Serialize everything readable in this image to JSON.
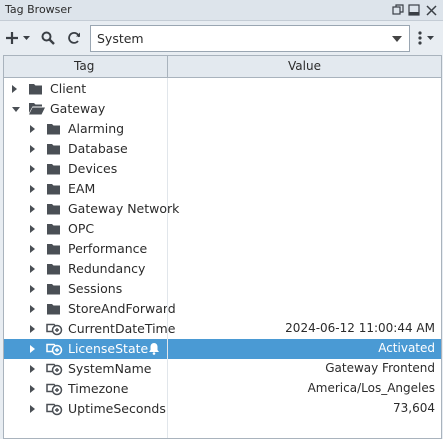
{
  "window": {
    "title": "Tag Browser"
  },
  "toolbar": {
    "provider": "System"
  },
  "table": {
    "col_tag": "Tag",
    "col_value": "Value"
  },
  "rows": [
    {
      "label": "Client",
      "value": "",
      "kind": "folder",
      "depth": 0,
      "expand": "right",
      "selected": false
    },
    {
      "label": "Gateway",
      "value": "",
      "kind": "folder-open",
      "depth": 0,
      "expand": "down",
      "selected": false
    },
    {
      "label": "Alarming",
      "value": "",
      "kind": "folder",
      "depth": 1,
      "expand": "right",
      "selected": false
    },
    {
      "label": "Database",
      "value": "",
      "kind": "folder",
      "depth": 1,
      "expand": "right",
      "selected": false
    },
    {
      "label": "Devices",
      "value": "",
      "kind": "folder",
      "depth": 1,
      "expand": "right",
      "selected": false
    },
    {
      "label": "EAM",
      "value": "",
      "kind": "folder",
      "depth": 1,
      "expand": "right",
      "selected": false
    },
    {
      "label": "Gateway Network",
      "value": "",
      "kind": "folder",
      "depth": 1,
      "expand": "right",
      "selected": false
    },
    {
      "label": "OPC",
      "value": "",
      "kind": "folder",
      "depth": 1,
      "expand": "right",
      "selected": false
    },
    {
      "label": "Performance",
      "value": "",
      "kind": "folder",
      "depth": 1,
      "expand": "right",
      "selected": false
    },
    {
      "label": "Redundancy",
      "value": "",
      "kind": "folder",
      "depth": 1,
      "expand": "right",
      "selected": false
    },
    {
      "label": "Sessions",
      "value": "",
      "kind": "folder",
      "depth": 1,
      "expand": "right",
      "selected": false
    },
    {
      "label": "StoreAndForward",
      "value": "",
      "kind": "folder",
      "depth": 1,
      "expand": "right",
      "selected": false
    },
    {
      "label": "CurrentDateTime",
      "value": "2024-06-12 11:00:44 AM",
      "kind": "tag",
      "depth": 1,
      "expand": "right",
      "selected": false
    },
    {
      "label": "LicenseState",
      "value": "Activated",
      "kind": "tag",
      "depth": 1,
      "expand": "right",
      "selected": true,
      "alarm": true
    },
    {
      "label": "SystemName",
      "value": "Gateway Frontend",
      "kind": "tag",
      "depth": 1,
      "expand": "right",
      "selected": false
    },
    {
      "label": "Timezone",
      "value": "America/Los_Angeles",
      "kind": "tag",
      "depth": 1,
      "expand": "right",
      "selected": false
    },
    {
      "label": "UptimeSeconds",
      "value": "73,604",
      "kind": "tag",
      "depth": 1,
      "expand": "right",
      "selected": false
    }
  ]
}
